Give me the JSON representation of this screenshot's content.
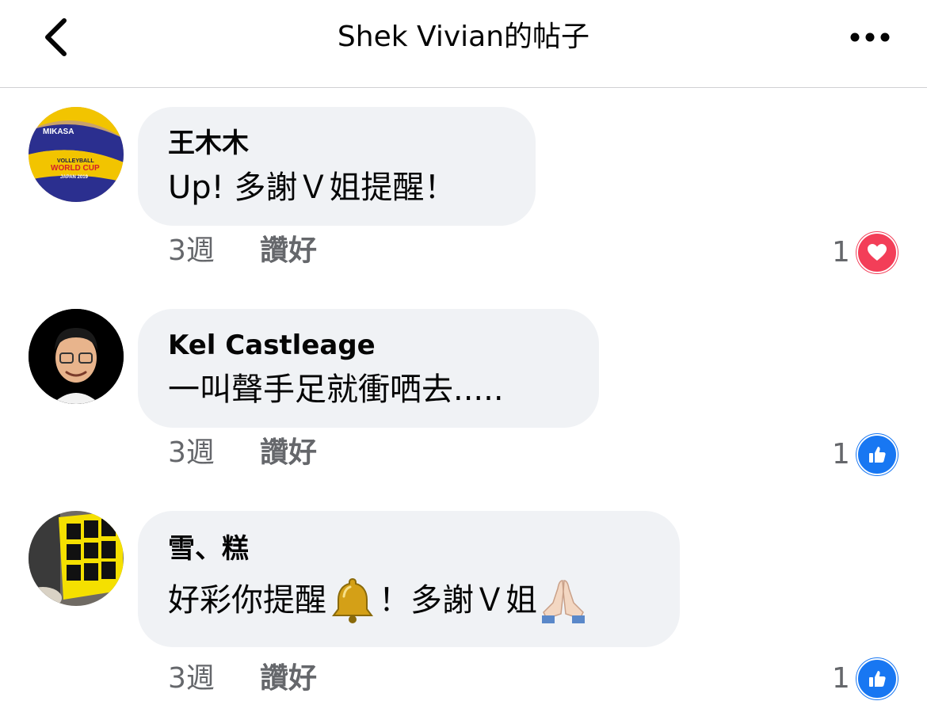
{
  "header": {
    "title": "Shek Vivian的帖子",
    "back_icon": "chevron-left-icon",
    "more_icon": "ellipsis-icon"
  },
  "comments": [
    {
      "author": "王木木",
      "text": "Up! 多謝Ｖ姐提醒！",
      "time": "3週",
      "like_label": "讚好",
      "reaction_count": "1",
      "reaction_type": "love",
      "avatar": "volleyball-avatar",
      "avatar_text": [
        "MIKASA",
        "VOLLEYBALL",
        "WORLD CUP",
        "JAPAN 2019"
      ]
    },
    {
      "author": "Kel Castleage",
      "text": "一叫聲手足就衝哂去.....",
      "time": "3週",
      "like_label": "讚好",
      "reaction_count": "1",
      "reaction_type": "like",
      "avatar": "memoji-avatar"
    },
    {
      "author": "雪、糕",
      "text_parts": [
        "好彩你提醒",
        "！多謝Ｖ姐"
      ],
      "emojis": [
        "bell-emoji",
        "praying-hands-emoji"
      ],
      "time": "3週",
      "like_label": "讚好",
      "reaction_count": "1",
      "reaction_type": "like",
      "avatar": "protest-sign-avatar"
    }
  ],
  "colors": {
    "bubble": "#f0f2f5",
    "meta_text": "#65676b",
    "like_blue": "#1877f2",
    "love_red": "#f33e58"
  }
}
